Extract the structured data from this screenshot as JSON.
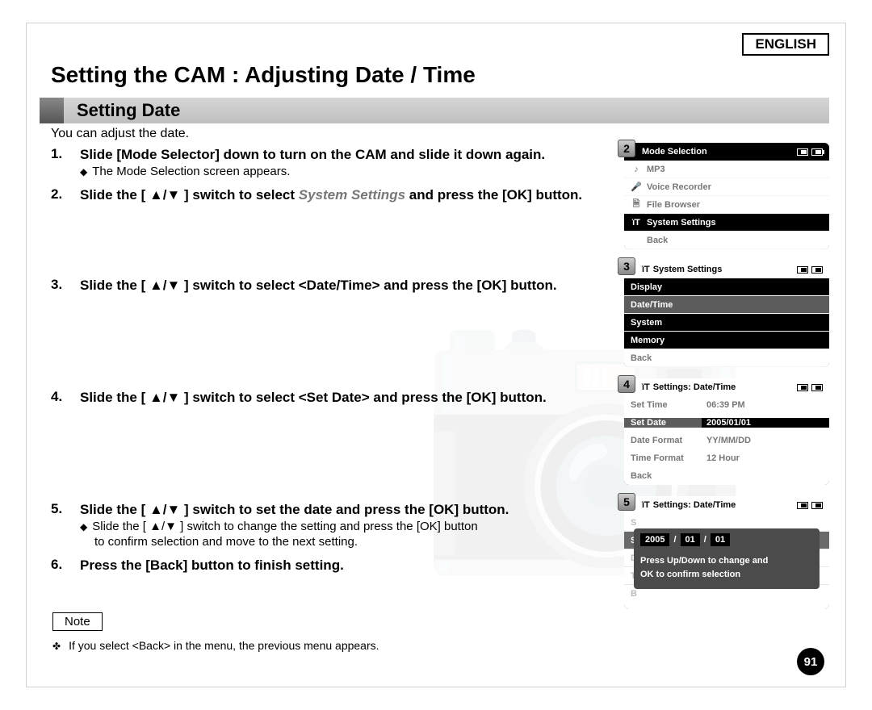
{
  "language_label": "ENGLISH",
  "h1": "Setting the CAM : Adjusting Date / Time",
  "subheader": "Setting Date",
  "intro": "You can adjust the date.",
  "steps": {
    "s1_main": "Slide [Mode Selector] down to turn on the CAM and slide it down again.",
    "s1_sub": "The Mode Selection screen appears.",
    "s2_pre": "Slide the [ ▲/▼ ] switch to select ",
    "s2_em": "System Settings",
    "s2_post": " and press the [OK] button.",
    "s3_main": "Slide the [ ▲/▼ ] switch to select <Date/Time> and press the [OK] button.",
    "s4_main": "Slide the [ ▲/▼ ] switch to select <Set Date> and press the [OK] button.",
    "s5_main": "Slide the [ ▲/▼ ] switch to set the date and press the [OK] button.",
    "s5_sub1": "Slide the [ ▲/▼ ] switch to change the setting and press the [OK] button",
    "s5_sub2": "to confirm selection and move to the next setting.",
    "s6_main": "Press the [Back] button to finish setting."
  },
  "note_label": "Note",
  "note_text": "If you select <Back> in the menu, the previous menu appears.",
  "page_number": "91",
  "screen2": {
    "title": "Mode Selection",
    "items": [
      "MP3",
      "Voice Recorder",
      "File Browser",
      "System Settings",
      "Back"
    ],
    "selected": "System Settings"
  },
  "screen3": {
    "title": "System Settings",
    "items": [
      "Display",
      "Date/Time",
      "System",
      "Memory",
      "Back"
    ],
    "selected": "Date/Time"
  },
  "screen4": {
    "title": "Settings: Date/Time",
    "rows": [
      {
        "k": "Set Time",
        "v": "06:39 PM"
      },
      {
        "k": "Set Date",
        "v": "2005/01/01"
      },
      {
        "k": "Date Format",
        "v": "YY/MM/DD"
      },
      {
        "k": "Time Format",
        "v": "12 Hour"
      },
      {
        "k": "Back",
        "v": ""
      }
    ],
    "selected": "Set Date"
  },
  "screen5": {
    "title": "Settings: Date/Time",
    "date_parts": [
      "2005",
      "01",
      "01"
    ],
    "msg1": "Press Up/Down to change and",
    "msg2": "OK to confirm selection"
  },
  "chart_data": {
    "type": "table",
    "note": "Instruction manual page with embedded device UI screenshots — not a chart."
  }
}
